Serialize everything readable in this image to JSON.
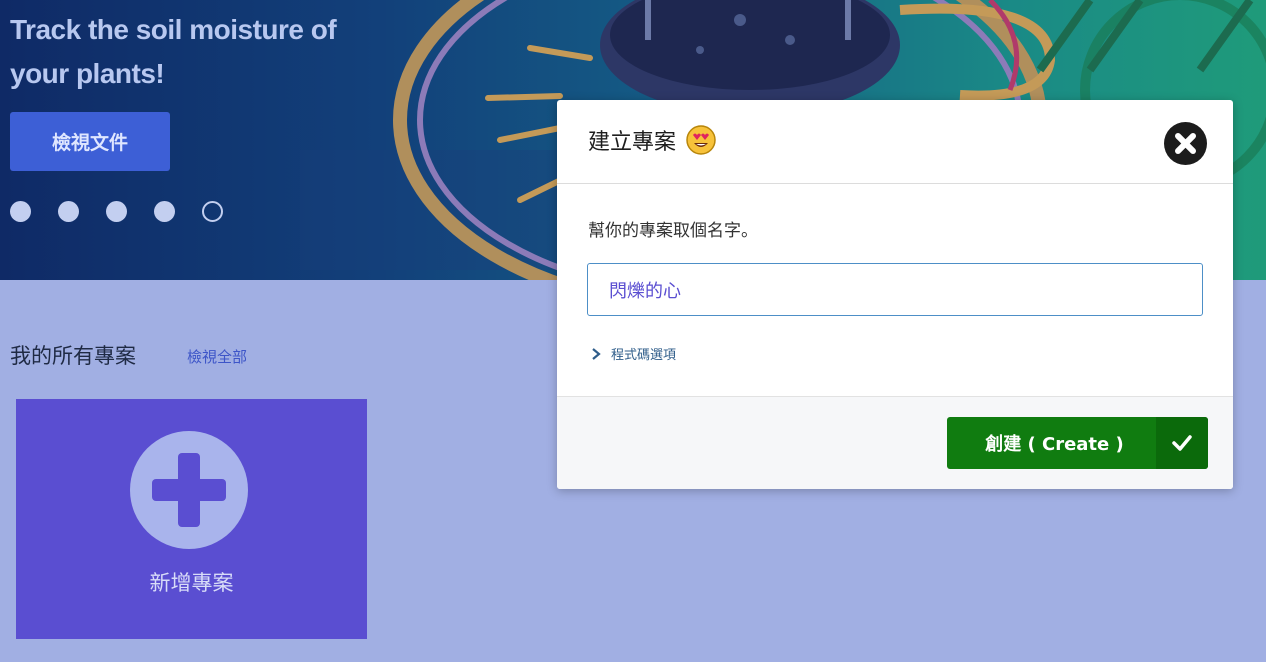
{
  "hero": {
    "title": "Track the soil moisture of your plants!",
    "button_label": "檢視文件",
    "carousel_dots": 5,
    "active_dot": 5
  },
  "projects": {
    "section_title": "我的所有專案",
    "view_all_label": "檢視全部",
    "new_project_label": "新增專案",
    "new_project_icon": "plus-icon"
  },
  "modal": {
    "title": "建立專案",
    "title_emoji": "heart-eyes-emoji",
    "close_icon": "close-icon",
    "prompt": "幫你的專案取個名字。",
    "name_value": "閃爍的心",
    "code_options_label": "程式碼選項",
    "create_label": "創建 ( Create )",
    "create_icon": "check-icon"
  },
  "colors": {
    "page_bg": "#a1afe3",
    "hero_button": "#3d5fd6",
    "new_project_card": "#5a4ed1",
    "create_button": "#107c10",
    "input_border": "#4d8fc7"
  }
}
